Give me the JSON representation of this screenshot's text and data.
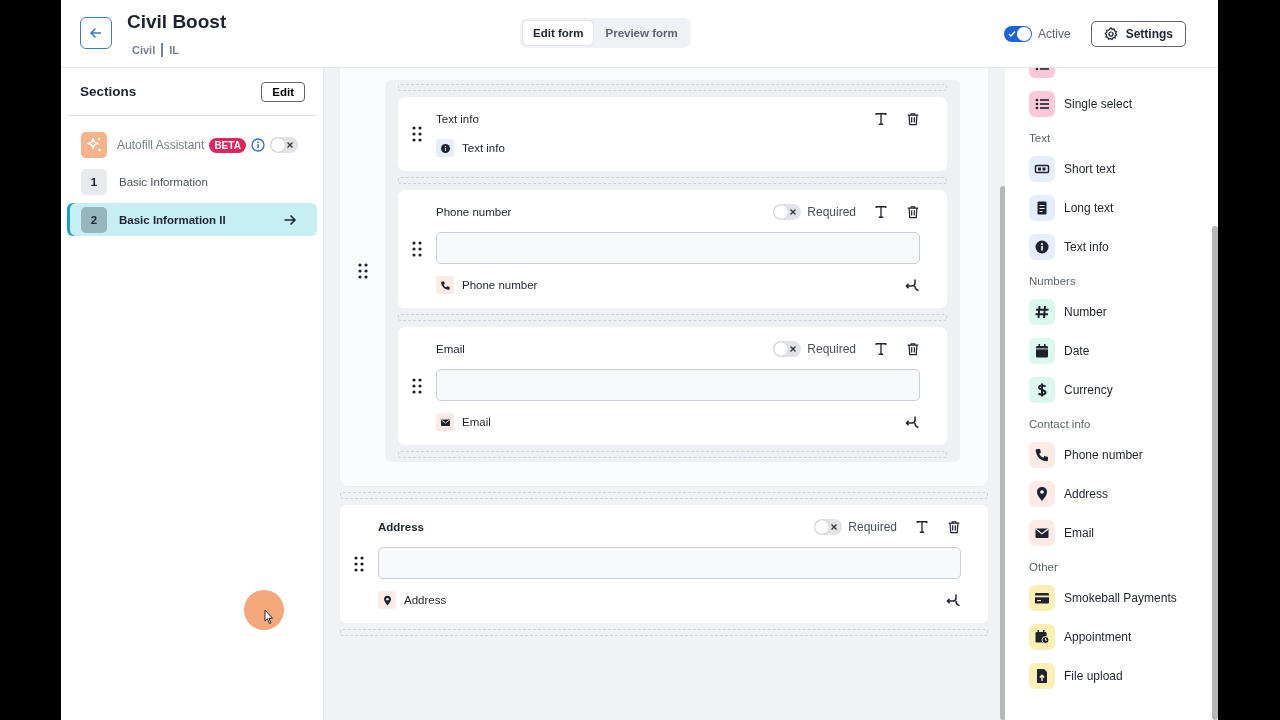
{
  "header": {
    "title": "Civil Boost",
    "subtitle": [
      "Civil",
      "IL"
    ],
    "tabs": [
      {
        "label": "Edit form",
        "selected": true
      },
      {
        "label": "Preview form",
        "selected": false
      }
    ],
    "active_toggle": {
      "label": "Active",
      "on": true
    },
    "settings_button": "Settings"
  },
  "sidebar": {
    "title": "Sections",
    "edit_button": "Edit",
    "assistant": {
      "label": "Autofill Assistant",
      "badge": "BETA",
      "on": false
    },
    "sections": [
      {
        "number": "1",
        "label": "Basic Information",
        "selected": false
      },
      {
        "number": "2",
        "label": "Basic Information II",
        "selected": true
      }
    ]
  },
  "group_fields": [
    {
      "kind": "info",
      "label": "Text info",
      "type_label": "Text info"
    },
    {
      "kind": "phone",
      "label": "Phone number",
      "required": false,
      "required_label": "Required",
      "type_label": "Phone number"
    },
    {
      "kind": "email",
      "label": "Email",
      "required": false,
      "required_label": "Required",
      "type_label": "Email"
    }
  ],
  "fields": [
    {
      "kind": "address",
      "label": "Address",
      "required": false,
      "required_label": "Required",
      "type_label": "Address"
    }
  ],
  "palette": [
    {
      "color": "#fbc8d8",
      "items": [
        {
          "kind": "list"
        },
        {
          "label": "Single select",
          "kind": "list"
        }
      ]
    },
    {
      "heading": "Text",
      "color": "#e6eefb",
      "items": [
        {
          "label": "Short text",
          "kind": "short_text"
        },
        {
          "label": "Long text",
          "kind": "long_text"
        },
        {
          "label": "Text info",
          "kind": "info"
        }
      ]
    },
    {
      "heading": "Numbers",
      "color": "#dcf7ee",
      "items": [
        {
          "label": "Number",
          "kind": "number"
        },
        {
          "label": "Date",
          "kind": "date"
        },
        {
          "label": "Currency",
          "kind": "currency"
        }
      ]
    },
    {
      "heading": "Contact info",
      "color": "#fbeae6",
      "items": [
        {
          "label": "Phone number",
          "kind": "phone"
        },
        {
          "label": "Address",
          "kind": "address"
        },
        {
          "label": "Email",
          "kind": "email"
        }
      ]
    },
    {
      "heading": "Other",
      "color": "#fbf0b4",
      "items": [
        {
          "label": "Smokeball Payments",
          "kind": "card"
        },
        {
          "label": "Appointment",
          "kind": "appointment"
        },
        {
          "label": "File upload",
          "kind": "file"
        }
      ]
    }
  ]
}
